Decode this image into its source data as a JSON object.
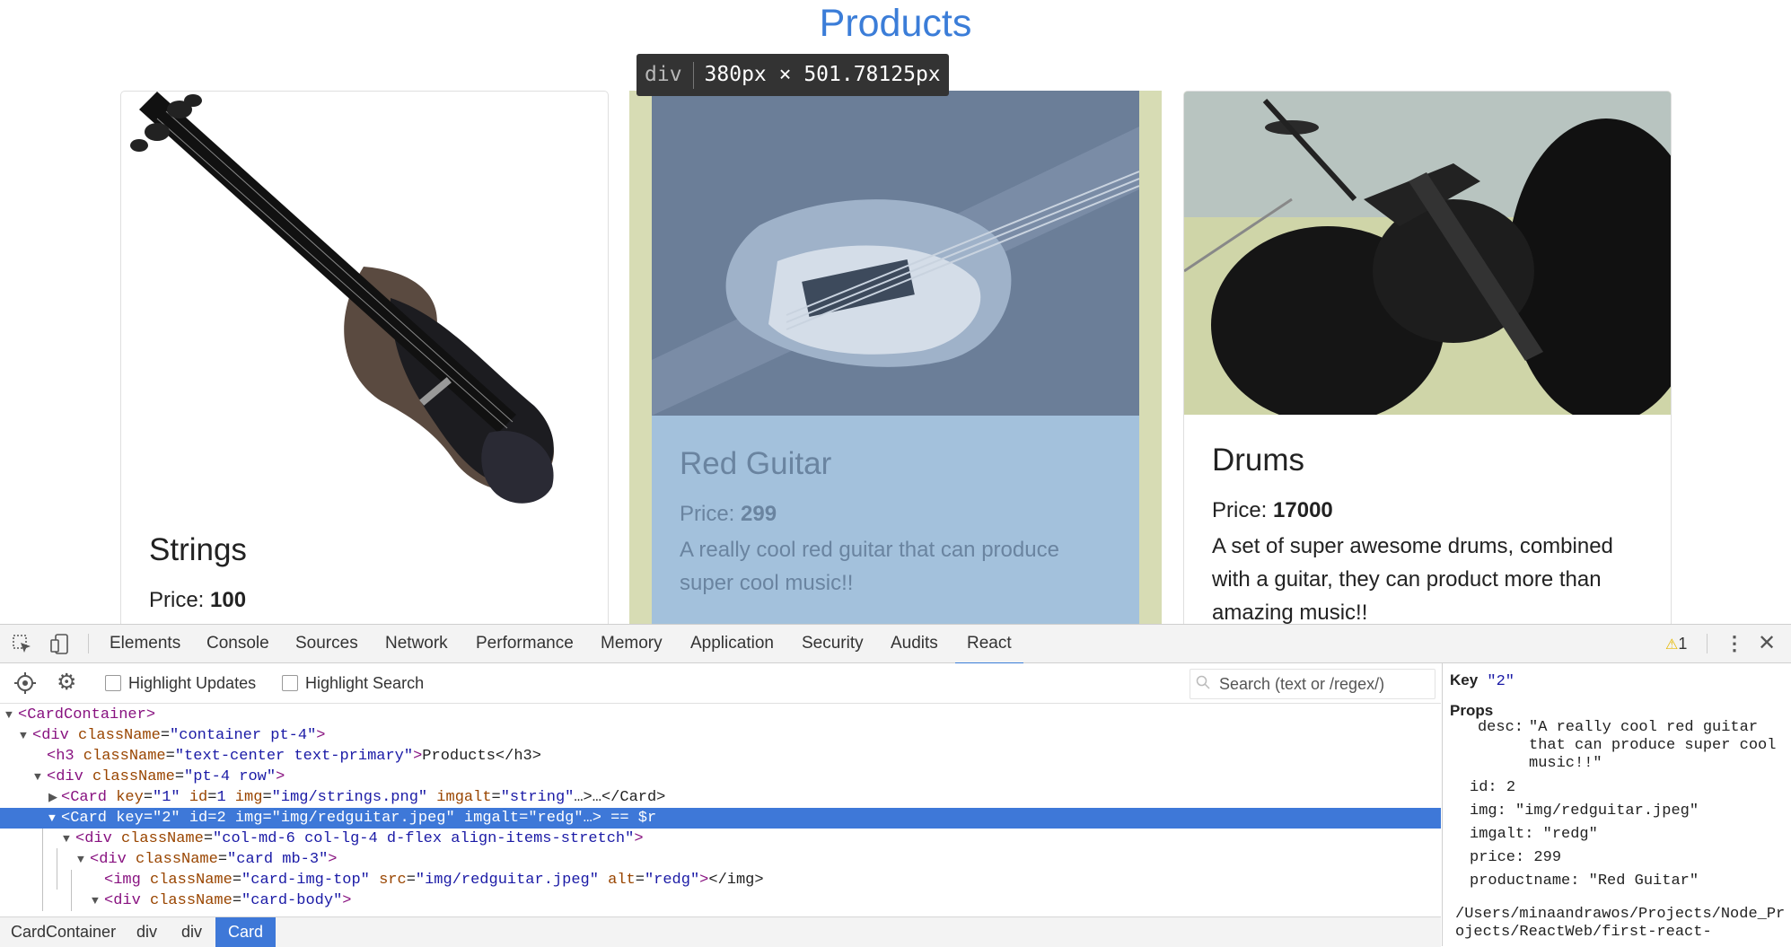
{
  "page": {
    "title": "Products",
    "cards": [
      {
        "name": "Strings",
        "price_label": "Price:",
        "price": "100",
        "desc": ""
      },
      {
        "name": "Red Guitar",
        "price_label": "Price:",
        "price": "299",
        "desc": "A really cool red guitar that can produce super cool music!!"
      },
      {
        "name": "Drums",
        "price_label": "Price:",
        "price": "17000",
        "desc": "A set of super awesome drums, combined with a guitar, they can product more than amazing music!!"
      }
    ],
    "inspect_tooltip": {
      "tag": "div",
      "size": "380px × 501.78125px"
    }
  },
  "devtools": {
    "tabs": [
      "Elements",
      "Console",
      "Sources",
      "Network",
      "Performance",
      "Memory",
      "Application",
      "Security",
      "Audits",
      "React"
    ],
    "active_tab": "React",
    "warning_count": "1",
    "toolbar": {
      "highlight_updates": "Highlight Updates",
      "highlight_search": "Highlight Search",
      "search_placeholder": "Search (text or /regex/)"
    },
    "tree": [
      {
        "indent": 0,
        "tri": "▼",
        "tag": "CardContainer",
        "attrs": [],
        "tail": ""
      },
      {
        "indent": 1,
        "tri": "▼",
        "tag": "div",
        "attrs": [
          [
            "className",
            "\"container pt-4\""
          ]
        ],
        "tail": ""
      },
      {
        "indent": 2,
        "tri": "",
        "tag": "h3",
        "attrs": [
          [
            "className",
            "\"text-center text-primary\""
          ]
        ],
        "tail": "Products</h3>"
      },
      {
        "indent": 2,
        "tri": "▼",
        "tag": "div",
        "attrs": [
          [
            "className",
            "\"pt-4 row\""
          ]
        ],
        "tail": ""
      },
      {
        "indent": 3,
        "tri": "▶",
        "tag": "Card",
        "attrs": [
          [
            "key",
            "\"1\""
          ],
          [
            "id",
            "1"
          ],
          [
            "img",
            "\"img/strings.png\""
          ],
          [
            "imgalt",
            "\"string\""
          ]
        ],
        "tail": "…>…</Card>"
      },
      {
        "indent": 3,
        "tri": "▼",
        "tag": "Card",
        "attrs": [
          [
            "key",
            "\"2\""
          ],
          [
            "id",
            "2"
          ],
          [
            "img",
            "\"img/redguitar.jpeg\""
          ],
          [
            "imgalt",
            "\"redg\""
          ]
        ],
        "tail": "…> == $r",
        "selected": true
      },
      {
        "indent": 4,
        "tri": "▼",
        "tag": "div",
        "attrs": [
          [
            "className",
            "\"col-md-6 col-lg-4 d-flex align-items-stretch\""
          ]
        ],
        "tail": ""
      },
      {
        "indent": 5,
        "tri": "▼",
        "tag": "div",
        "attrs": [
          [
            "className",
            "\"card mb-3\""
          ]
        ],
        "tail": ""
      },
      {
        "indent": 6,
        "tri": "",
        "tag": "img",
        "attrs": [
          [
            "className",
            "\"card-img-top\""
          ],
          [
            "src",
            "\"img/redguitar.jpeg\""
          ],
          [
            "alt",
            "\"redg\""
          ]
        ],
        "tail": "</img>"
      },
      {
        "indent": 6,
        "tri": "▼",
        "tag": "div",
        "attrs": [
          [
            "className",
            "\"card-body\""
          ]
        ],
        "tail": ""
      }
    ],
    "breadcrumbs": [
      "CardContainer",
      "div",
      "div",
      "Card"
    ],
    "side": {
      "key_label": "Key",
      "key_value": "\"2\"",
      "props_label": "Props",
      "props": [
        {
          "name": "desc:",
          "value": "\"A really cool red guitar that can produce super cool music!!\""
        },
        {
          "name": "id:",
          "value": "2"
        },
        {
          "name": "img:",
          "value": "\"img/redguitar.jpeg\""
        },
        {
          "name": "imgalt:",
          "value": "\"redg\""
        },
        {
          "name": "price:",
          "value": "299"
        },
        {
          "name": "productname:",
          "value": "\"Red Guitar\""
        }
      ],
      "path": "/Users/minaandrawos/Projects/Node_Projects/ReactWeb/first-react-"
    }
  }
}
